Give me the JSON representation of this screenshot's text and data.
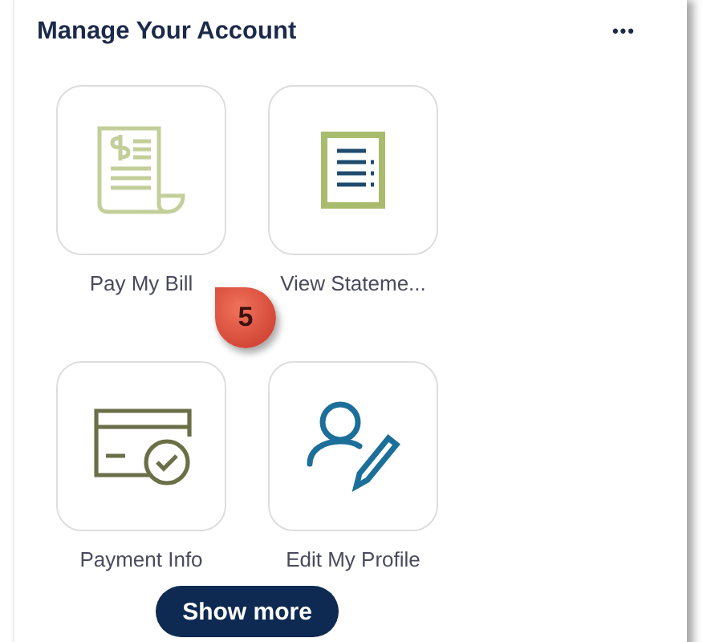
{
  "card": {
    "title": "Manage Your Account",
    "menu": "•••"
  },
  "tiles": [
    {
      "kind": "bill",
      "label": "Pay My Bill"
    },
    {
      "kind": "statement",
      "label": "View Stateme..."
    },
    {
      "kind": "card",
      "label": "Payment Info"
    },
    {
      "kind": "profile",
      "label": "Edit My Profile"
    }
  ],
  "callout": {
    "number": "5"
  },
  "button": {
    "label": "Show more"
  }
}
